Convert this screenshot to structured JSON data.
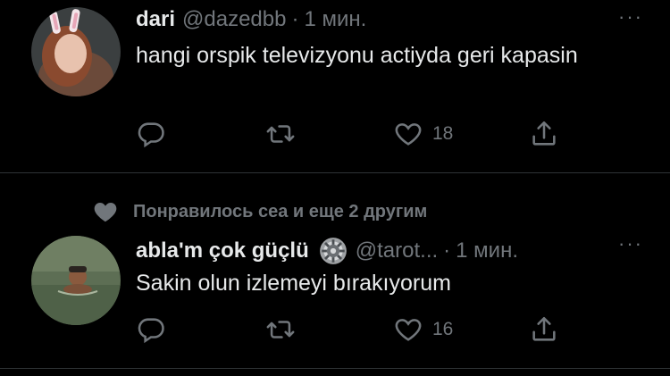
{
  "tweets": [
    {
      "name": "dari",
      "handle": "@dazedbb",
      "separator": "·",
      "time": "1 мин.",
      "text": "hangi orspik televizyonu actiyda geri kapasin",
      "reply_count": "",
      "retweet_count": "",
      "like_count": "18"
    },
    {
      "social_context": "Понравилось сеа и еще 2 другим",
      "name": "abla'm çok güçlü",
      "handle": "@tarot...",
      "separator": "·",
      "time": "1 мин.",
      "text": "Sakin olun izlemeyi bırakıyorum",
      "reply_count": "",
      "retweet_count": "",
      "like_count": "16"
    }
  ],
  "more_label": "···",
  "icons": {
    "reply": "reply-icon",
    "retweet": "retweet-icon",
    "like": "heart-icon",
    "share": "share-icon",
    "social": "heart-filled-icon",
    "badge": "gear-badge-icon"
  },
  "colors": {
    "background": "#000000",
    "text": "#e7e9ea",
    "muted": "#71767b",
    "divider": "#2f3336"
  }
}
